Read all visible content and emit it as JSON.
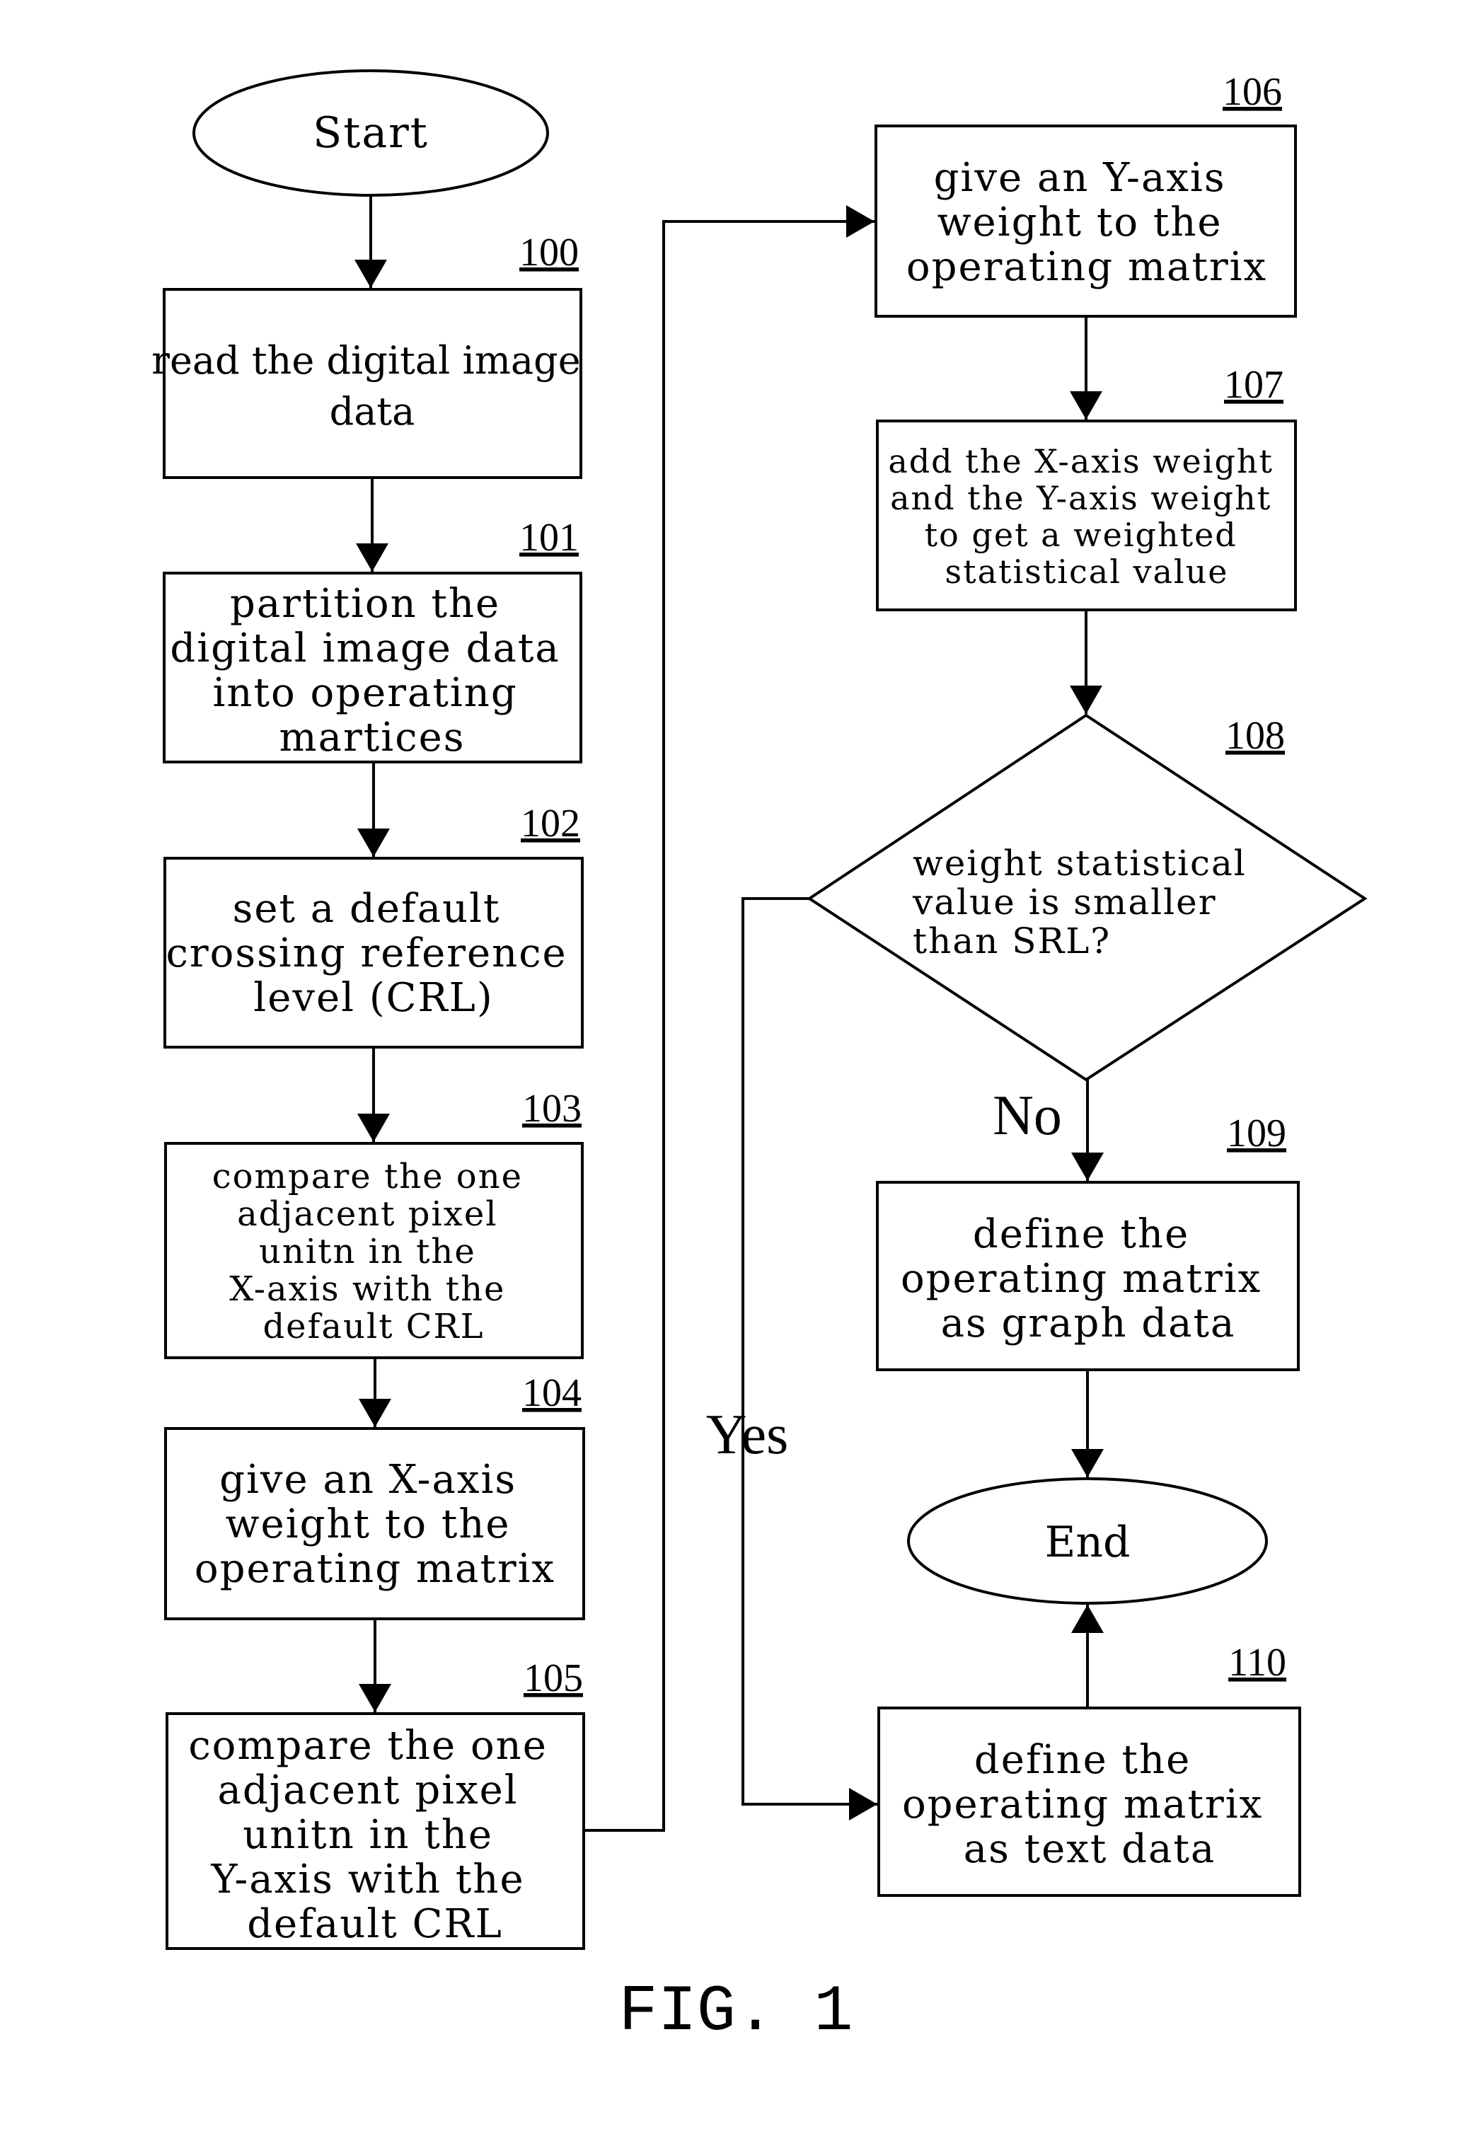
{
  "figure": {
    "caption": "FIG. 1",
    "colors": {
      "line": "#000000",
      "background": "#ffffff"
    }
  },
  "nodes": {
    "start": {
      "label": "Start"
    },
    "s100": {
      "ref": "100",
      "lines": [
        "read the digital image",
        "data"
      ]
    },
    "s101": {
      "ref": "101",
      "lines": [
        "partition the",
        "digital image data",
        "into operating",
        "martices"
      ]
    },
    "s102": {
      "ref": "102",
      "lines": [
        "set a default",
        "crossing reference",
        "level (CRL)"
      ]
    },
    "s103": {
      "ref": "103",
      "lines": [
        "compare the one",
        "adjacent pixel",
        "unitn in the",
        "X-axis with the",
        "default CRL"
      ]
    },
    "s104": {
      "ref": "104",
      "lines": [
        "give an X-axis",
        "weight to the",
        "operating matrix"
      ]
    },
    "s105": {
      "ref": "105",
      "lines": [
        "compare the one",
        "adjacent pixel",
        "unitn in the",
        "Y-axis with the",
        "default CRL"
      ]
    },
    "s106": {
      "ref": "106",
      "lines": [
        "give an Y-axis",
        "weight to the",
        "operating matrix"
      ]
    },
    "s107": {
      "ref": "107",
      "lines": [
        "add the X-axis weight",
        "and the Y-axis weight",
        "to get a weighted",
        "statistical value"
      ]
    },
    "s108": {
      "ref": "108",
      "lines": [
        "weight statistical",
        "value is smaller",
        "than SRL?"
      ]
    },
    "s109": {
      "ref": "109",
      "lines": [
        "define the",
        "operating matrix",
        "as graph data"
      ]
    },
    "s110": {
      "ref": "110",
      "lines": [
        "define the",
        "operating matrix",
        "as text data"
      ]
    },
    "end": {
      "label": "End"
    }
  },
  "branches": {
    "no": "No",
    "yes": "Yes"
  }
}
